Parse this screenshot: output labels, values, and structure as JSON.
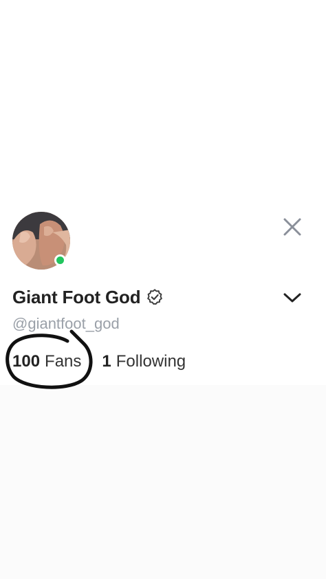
{
  "profile": {
    "display_name": "Giant Foot God",
    "handle": "@giantfoot_god",
    "verified": true,
    "online": true,
    "avatar_icon": "profile-photo"
  },
  "stats": {
    "fans_count": "100",
    "fans_label": "Fans",
    "following_count": "1",
    "following_label": "Following"
  },
  "controls": {
    "close_icon": "close-icon",
    "expand_icon": "chevron-down-icon"
  },
  "colors": {
    "online": "#22c55e",
    "handle": "#9aa0a8",
    "close_icon": "#8a8f99",
    "annotation": "#111111"
  }
}
